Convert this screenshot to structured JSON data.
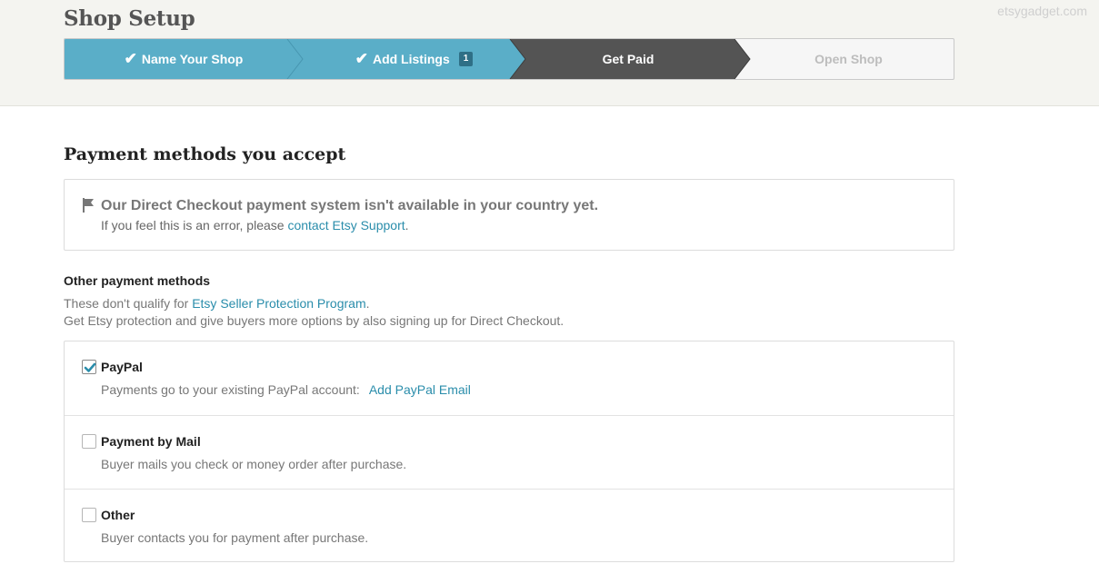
{
  "watermark": "etsygadget.com",
  "page_title": "Shop Setup",
  "steps": [
    {
      "label": "Name Your Shop",
      "state": "done"
    },
    {
      "label": "Add Listings",
      "state": "done",
      "badge": "1"
    },
    {
      "label": "Get Paid",
      "state": "current"
    },
    {
      "label": "Open Shop",
      "state": "upcoming"
    }
  ],
  "colors": {
    "step_done": "#5aaec8",
    "step_current": "#545454",
    "step_upcoming": "#f6f6f6",
    "link": "#2a8dab",
    "checkbox_checked": "#2a8dab"
  },
  "section_title": "Payment methods you accept",
  "notice": {
    "icon": "flag-icon",
    "title": "Our Direct Checkout payment system isn't available in your country yet.",
    "text_before": "If you feel this is an error, please ",
    "link": "contact Etsy Support",
    "text_after": "."
  },
  "other": {
    "title": "Other payment methods",
    "line1_before": "These don't qualify for ",
    "line1_link": "Etsy Seller Protection Program",
    "line1_after": ".",
    "line2": "Get Etsy protection and give buyers more options by also signing up for Direct Checkout."
  },
  "methods": [
    {
      "title": "PayPal",
      "checked": true,
      "desc": "Payments go to your existing PayPal account:",
      "link": "Add PayPal Email"
    },
    {
      "title": "Payment by Mail",
      "checked": false,
      "desc": "Buyer mails you check or money order after purchase."
    },
    {
      "title": "Other",
      "checked": false,
      "desc": "Buyer contacts you for payment after purchase."
    }
  ]
}
